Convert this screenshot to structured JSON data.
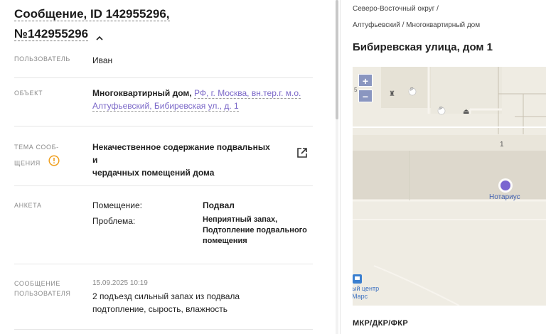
{
  "message": {
    "title_line1": "Сообщение, ID 142955296,",
    "title_line2": "№142955296"
  },
  "fields": {
    "user_label": "ПОЛЬЗОВАТЕЛЬ",
    "user_value": "Иван",
    "object_label": "ОБЪЕКТ",
    "object_type": "Многоквартирный дом,",
    "object_link_line1": "РФ, г. Москва, вн.тер.г. м.о.",
    "object_link_line2": "Алтуфьевский, Бибиревская ул., д. 1",
    "topic_label_line1": "ТЕМА СООБ-",
    "topic_label_line2": "ЩЕНИЯ",
    "topic_value_line1": "Некачественное содержание подвальных и",
    "topic_value_line2": "чердачных помещений дома",
    "survey_label": "АНКЕТА",
    "survey": [
      {
        "key": "Помещение:",
        "value_lines": [
          "Подвал"
        ]
      },
      {
        "key": "Проблема:",
        "value_lines": [
          "Неприятный запах,",
          "Подтопление подвального",
          "помещения"
        ]
      }
    ],
    "msg_label_line1": "СООБЩЕНИЕ",
    "msg_label_line2": "ПОЛЬЗОВАТЕЛЯ",
    "msg_date": "15.09.2025 10:19",
    "msg_text_line1": "2 подъезд сильный запах из подвала",
    "msg_text_line2": "подтопление, сырость, влажность"
  },
  "location": {
    "breadcrumb_line1": "Северо-Восточный округ /",
    "breadcrumb_line2": "Алтуфьевский / Многоквартирный дом",
    "address": "Бибиревская улица, дом 1",
    "map": {
      "zoom_in": "+",
      "zoom_out": "−",
      "house_number": "1",
      "poi_label": "Нотариус",
      "bus_stop_line1": "ый центр",
      "bus_stop_line2": "Марс",
      "small_number": "5",
      "parking_glyph": "P"
    },
    "section_title": "МКР/ДКР/ФКР"
  },
  "colors": {
    "accent": "#7b68c8",
    "warning": "#f0a020",
    "map_bg": "#efece3",
    "map_road": "#e2ddd0",
    "map_zoom": "#8a96c0",
    "poi": "#7a66d0"
  }
}
